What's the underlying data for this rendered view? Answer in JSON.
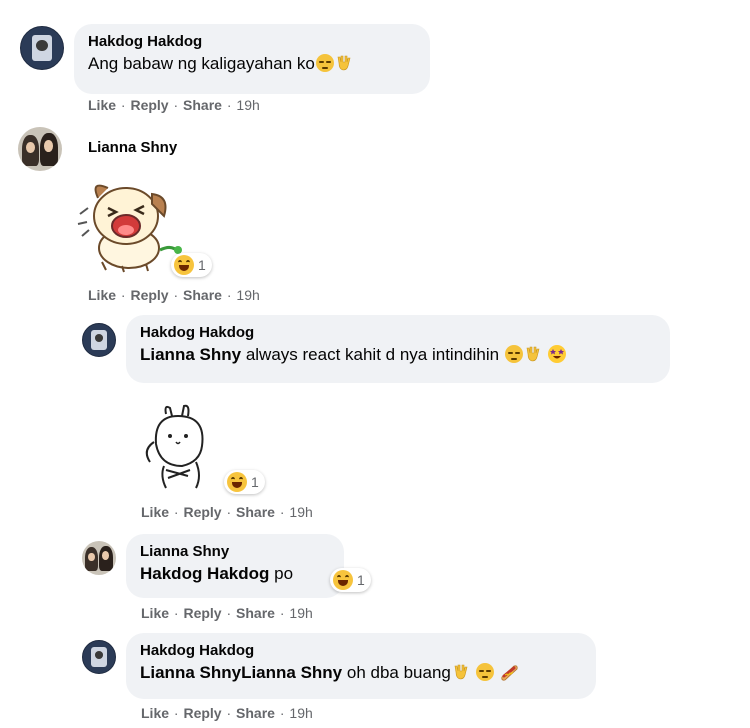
{
  "comments": [
    {
      "author": "Hakdog Hakdog",
      "text": "Ang babaw ng kaligayahan ko",
      "actions": {
        "like": "Like",
        "reply": "Reply",
        "share": "Share",
        "time": "19h"
      }
    },
    {
      "author": "Lianna Shny",
      "sticker": "laughing-dog-sticker",
      "reaction": {
        "type": "haha",
        "count": "1"
      },
      "actions": {
        "like": "Like",
        "reply": "Reply",
        "share": "Share",
        "time": "19h"
      }
    }
  ],
  "replies": [
    {
      "author": "Hakdog Hakdog",
      "mention": "Lianna Shny",
      "text": "always react kahit d nya intindihin",
      "sticker": "shrugging-bunny-sticker",
      "reaction": {
        "type": "haha",
        "count": "1"
      },
      "actions": {
        "like": "Like",
        "reply": "Reply",
        "share": "Share",
        "time": "19h"
      }
    },
    {
      "author": "Lianna Shny",
      "mention": "Hakdog Hakdog",
      "text": "po",
      "reaction": {
        "type": "haha",
        "count": "1"
      },
      "actions": {
        "like": "Like",
        "reply": "Reply",
        "share": "Share",
        "time": "19h"
      }
    },
    {
      "author": "Hakdog Hakdog",
      "mention": "Lianna ShnyLianna Shny",
      "text": "oh dba buang",
      "actions": {
        "like": "Like",
        "reply": "Reply",
        "share": "Share",
        "time": "19h"
      }
    }
  ],
  "colors": {
    "bubble": "#f0f2f5",
    "meta": "#65676b",
    "text": "#050505"
  },
  "emoji_names": [
    "disappointed-face",
    "vulcan-salute",
    "star-struck",
    "hotdog",
    "haha-reaction"
  ]
}
